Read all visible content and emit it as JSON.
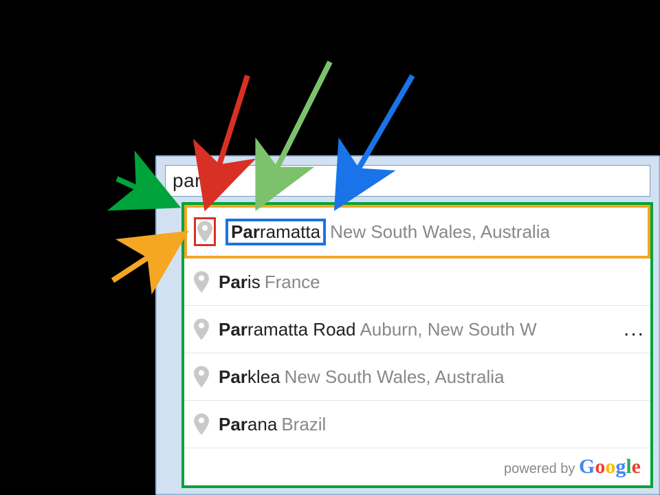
{
  "search": {
    "value": "par",
    "placeholder": ""
  },
  "suggestions": [
    {
      "icon": "pin-marker-icon",
      "match": "Par",
      "rest": "ramatta",
      "secondary": "New South Wales, Australia"
    },
    {
      "icon": "pin-marker-icon",
      "match": "Par",
      "rest": "is",
      "secondary": "France"
    },
    {
      "icon": "pin-marker-icon",
      "match": "Par",
      "rest": "ramatta Road",
      "secondary": "Auburn, New South W",
      "overflow": "..."
    },
    {
      "icon": "pin-marker-icon",
      "match": "Par",
      "rest": "klea",
      "secondary": "New South Wales, Australia"
    },
    {
      "icon": "pin-marker-icon",
      "match": "Par",
      "rest": "ana",
      "secondary": "Brazil"
    }
  ],
  "attribution": {
    "prefix": "powered by ",
    "brand": "Google"
  },
  "annotations": {
    "highlight_box_dropdown": "#00a33b",
    "highlight_box_item": "#f5a623",
    "highlight_box_icon": "#d93025",
    "highlight_box_name": "#1a73e8",
    "arrow_colors": {
      "dropdown_arrow": "#00a33b",
      "item_arrow": "#f5a623",
      "icon_arrow": "#d93025",
      "match_arrow": "#7cc26c",
      "name_arrow": "#1a73e8"
    }
  }
}
